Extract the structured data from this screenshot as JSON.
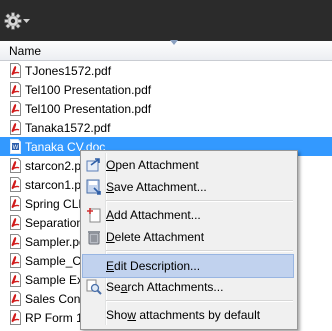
{
  "toolbar": {
    "gear_icon": "gear-icon",
    "dropdown_icon": "chevron-down-icon"
  },
  "list": {
    "column_header": "Name",
    "files": [
      {
        "name": "TJones1572.pdf",
        "type": "pdf"
      },
      {
        "name": "Tel100 Presentation.pdf",
        "type": "pdf"
      },
      {
        "name": "Tel100 Presentation.pdf",
        "type": "pdf"
      },
      {
        "name": "Tanaka1572.pdf",
        "type": "pdf"
      },
      {
        "name": "Tanaka CV.doc",
        "type": "doc",
        "selected": true
      },
      {
        "name": "starcon2.p",
        "type": "pdf"
      },
      {
        "name": "starcon1.p",
        "type": "pdf"
      },
      {
        "name": "Spring CLE",
        "type": "pdf"
      },
      {
        "name": "Separation",
        "type": "pdf"
      },
      {
        "name": "Sampler.pd",
        "type": "pdf"
      },
      {
        "name": "Sample_Co",
        "type": "pdf"
      },
      {
        "name": "Sample Exp",
        "type": "pdf"
      },
      {
        "name": "Sales Cont",
        "type": "pdf"
      },
      {
        "name": "RP Form 1",
        "type": "pdf"
      }
    ]
  },
  "context_menu": {
    "items": [
      {
        "key": "O",
        "rest": "pen Attachment",
        "icon": "open-attachment-icon"
      },
      {
        "key": "S",
        "rest": "ave Attachment...",
        "icon": "save-attachment-icon"
      },
      {
        "key": "A",
        "rest": "dd Attachment...",
        "icon": "add-attachment-icon"
      },
      {
        "key": "D",
        "rest": "elete Attachment",
        "icon": "delete-attachment-icon"
      },
      {
        "key": "E",
        "rest": "dit Description...",
        "icon": "",
        "highlighted": true
      },
      {
        "pre": "Se",
        "key": "a",
        "rest": "rch Attachments...",
        "icon": "search-attachments-icon"
      },
      {
        "pre": "Sho",
        "key": "w",
        "rest": " attachments by default",
        "icon": ""
      }
    ]
  }
}
